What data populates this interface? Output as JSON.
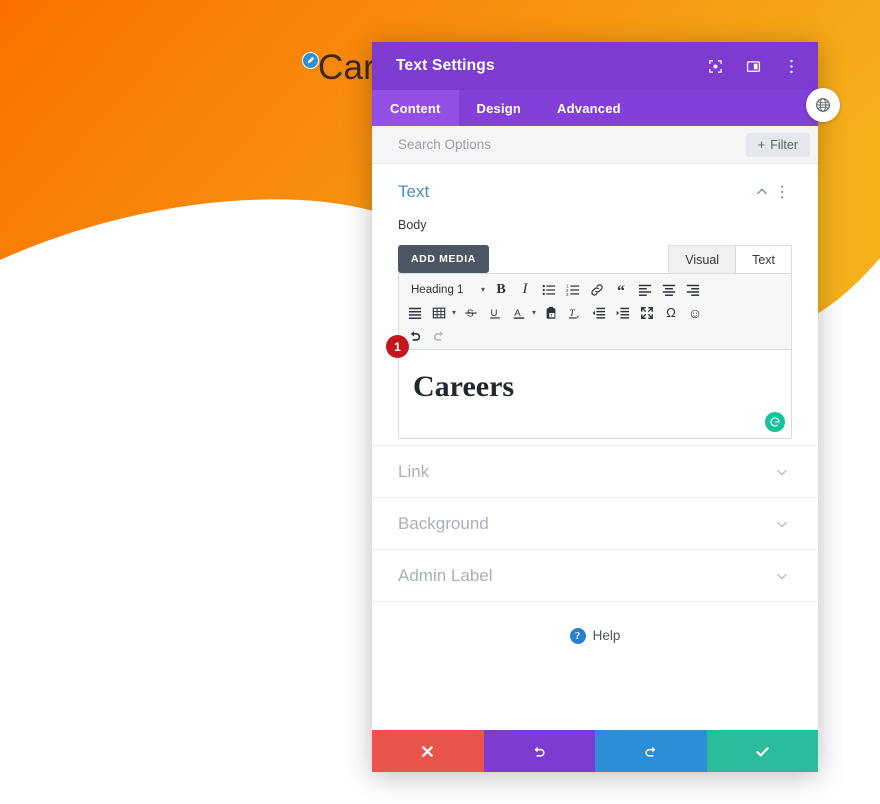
{
  "background_page": {
    "hero_heading": "Careers",
    "hero_gradient_start": "#fa7000",
    "hero_gradient_end": "#f5b01a",
    "edit_badge_icon": "pencil-icon",
    "globe_fab_icon": "globe-icon"
  },
  "modal": {
    "title": "Text Settings",
    "accent_color": "#7e3bd0",
    "titlebar_icons": [
      {
        "name": "focus-target-icon",
        "label": "Focus Mode"
      },
      {
        "name": "split-panel-icon",
        "label": "Panel Layout"
      },
      {
        "name": "more-vertical-icon",
        "label": "More Options"
      }
    ],
    "tabs": [
      {
        "label": "Content",
        "active": true
      },
      {
        "label": "Design",
        "active": false
      },
      {
        "label": "Advanced",
        "active": false
      }
    ],
    "search": {
      "value": "",
      "placeholder": "Search Options",
      "filter_label": "Filter",
      "filter_plus": "+"
    },
    "text_section": {
      "title": "Text",
      "body_label": "Body",
      "add_media_label": "ADD MEDIA",
      "mode_tabs": [
        {
          "label": "Visual",
          "active": false
        },
        {
          "label": "Text",
          "active": true
        }
      ],
      "toolbar": {
        "format_select": "Heading 1",
        "caret": "▾",
        "row1": [
          {
            "name": "bold-icon",
            "glyph": "B"
          },
          {
            "name": "italic-icon",
            "glyph": "I"
          },
          {
            "name": "bullet-list-icon",
            "glyph": ""
          },
          {
            "name": "numbered-list-icon",
            "glyph": ""
          },
          {
            "name": "link-icon",
            "glyph": ""
          },
          {
            "name": "blockquote-icon",
            "glyph": "“"
          },
          {
            "name": "align-left-icon",
            "glyph": ""
          },
          {
            "name": "align-center-icon",
            "glyph": ""
          },
          {
            "name": "align-right-icon",
            "glyph": ""
          }
        ],
        "row2": [
          {
            "name": "align-justify-icon"
          },
          {
            "name": "table-icon"
          },
          {
            "name": "strikethrough-icon",
            "glyph": "S"
          },
          {
            "name": "underline-icon",
            "glyph": "U"
          },
          {
            "name": "text-color-icon",
            "glyph": "A"
          },
          {
            "name": "paste-as-text-icon"
          },
          {
            "name": "clear-formatting-icon"
          },
          {
            "name": "outdent-icon"
          },
          {
            "name": "indent-icon"
          },
          {
            "name": "fullscreen-icon"
          },
          {
            "name": "special-character-icon",
            "glyph": "Ω"
          },
          {
            "name": "emoji-icon",
            "glyph": "☺"
          }
        ],
        "row3": [
          {
            "name": "undo-icon",
            "disabled": false
          },
          {
            "name": "redo-icon",
            "disabled": true
          }
        ]
      },
      "content_text": "Careers",
      "step_badge": "1",
      "grammarly_icon": "grammarly-icon"
    },
    "collapsed_sections": [
      {
        "title": "Link"
      },
      {
        "title": "Background"
      },
      {
        "title": "Admin Label"
      }
    ],
    "help": {
      "icon_glyph": "?",
      "label": "Help"
    },
    "footer_buttons": [
      {
        "name": "cancel-button",
        "icon": "close-icon",
        "color": "#e9544d"
      },
      {
        "name": "undo-button",
        "icon": "undo-icon",
        "color": "#7e3bd0"
      },
      {
        "name": "redo-button",
        "icon": "redo-icon",
        "color": "#2a8fd8"
      },
      {
        "name": "save-button",
        "icon": "check-icon",
        "color": "#2bbc9b"
      }
    ]
  }
}
